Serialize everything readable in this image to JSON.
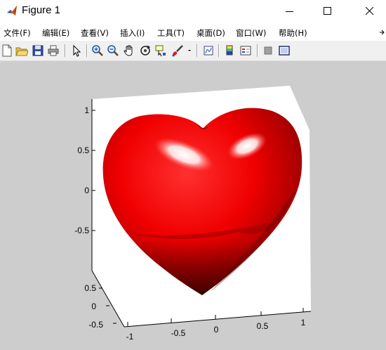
{
  "window": {
    "title": "Figure 1",
    "controls": [
      "minimize",
      "maximize",
      "close"
    ]
  },
  "menu": {
    "items": [
      "文件(F)",
      "编辑(E)",
      "查看(V)",
      "插入(I)",
      "工具(T)",
      "桌面(D)",
      "窗口(W)",
      "帮助(H)"
    ]
  },
  "toolbar": {
    "buttons": [
      "new-figure",
      "open-file",
      "save",
      "print",
      "edit-plot",
      "zoom-in",
      "zoom-out",
      "pan",
      "rotate-3d",
      "data-cursor",
      "brush",
      "link-plot",
      "insert-colorbar",
      "insert-legend",
      "hide-plot-tools",
      "show-plot-tools"
    ]
  },
  "axes": {
    "z_ticks": [
      "1",
      "0.5",
      "0",
      "-0.5"
    ],
    "y_ticks": [
      "0.5",
      "0",
      "-0.5"
    ],
    "x_ticks": [
      "-1",
      "-0.5",
      "0",
      "0.5",
      "1"
    ]
  },
  "surface": {
    "shape": "heart",
    "color": "#ff0000"
  },
  "colors": {
    "canvas_bg": "#cdcdcd",
    "toolbar_bg": "#f0f0f0"
  }
}
